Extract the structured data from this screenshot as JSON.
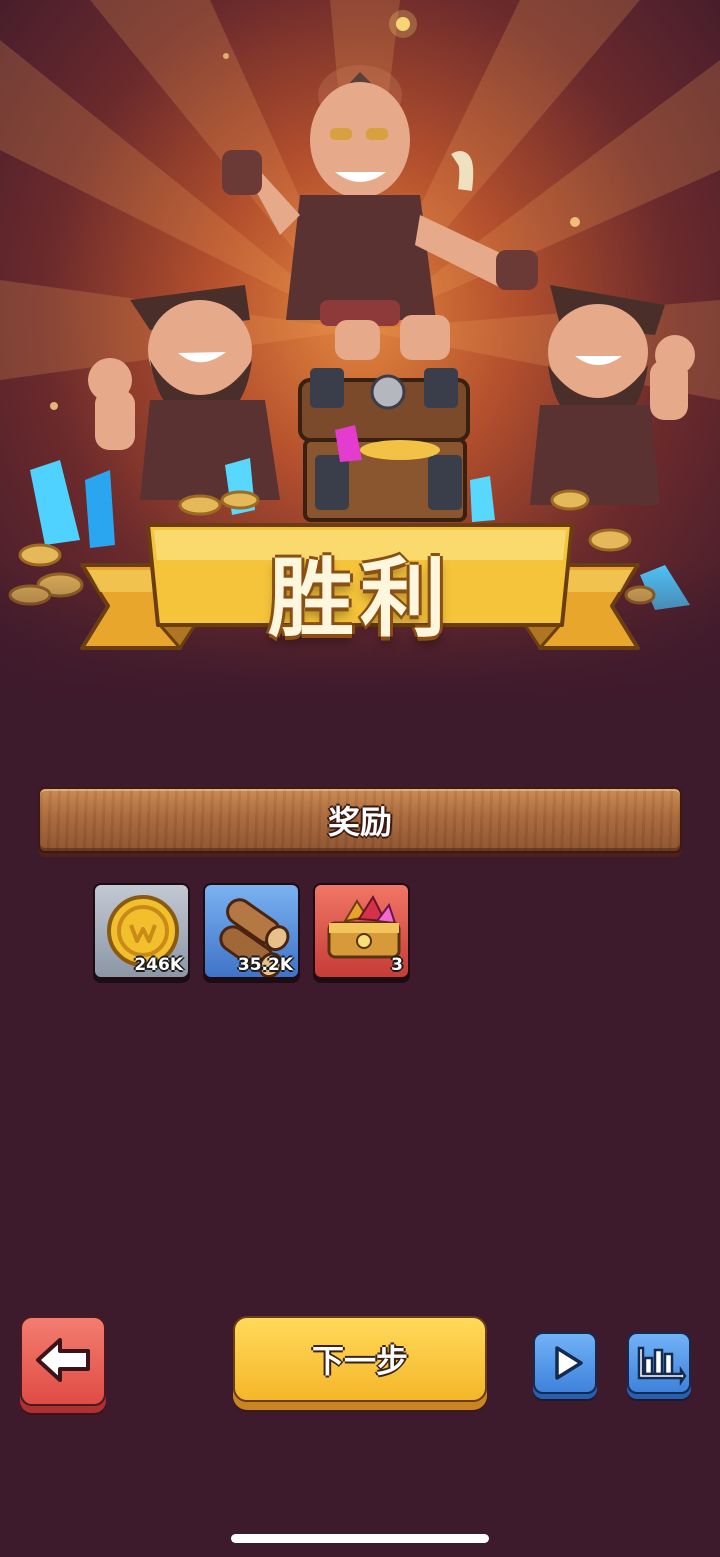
{
  "banner": {
    "title": "胜利"
  },
  "rewards": {
    "header": "奖励",
    "items": [
      {
        "name": "gold-coin",
        "count": "246K",
        "tile_color": "#a8b0bd"
      },
      {
        "name": "wood-logs",
        "count": "35.2K",
        "tile_color": "#5b8fdb"
      },
      {
        "name": "gem-chest",
        "count": "3",
        "tile_color": "#e05a4e"
      }
    ]
  },
  "buttons": {
    "next_label": "下一步",
    "back_icon": "arrow-left-icon",
    "play_icon": "play-icon",
    "stats_icon": "bar-chart-icon"
  },
  "colors": {
    "background": "#3d1a2c",
    "banner_gold": "#f5c43a",
    "next_button": "#f5b72a",
    "back_button": "#df4c45",
    "blue_button": "#3e82dc"
  }
}
